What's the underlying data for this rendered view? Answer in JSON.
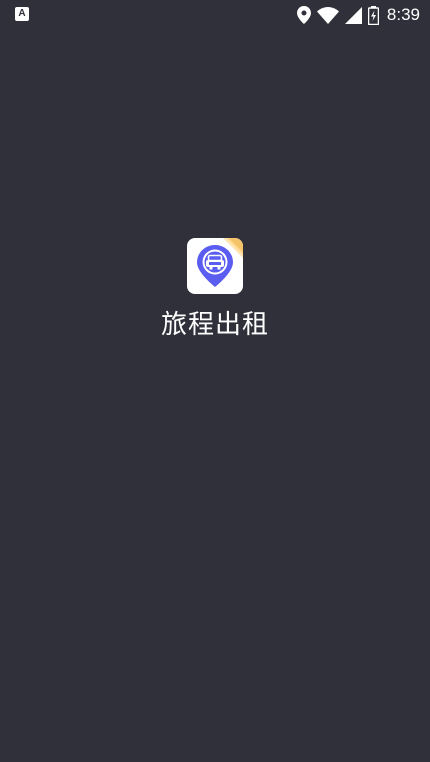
{
  "status_bar": {
    "notification_icon_letter": "A",
    "time": "8:39",
    "icons": [
      "location-icon",
      "wifi-icon",
      "signal-icon",
      "battery-icon"
    ]
  },
  "splash": {
    "app_name": "旅程出租",
    "logo_icon": "taxi-location-pin-icon",
    "colors": {
      "background": "#30303a",
      "logo_pin": "#5b5cf0",
      "logo_corner": "#f5c46a"
    }
  }
}
